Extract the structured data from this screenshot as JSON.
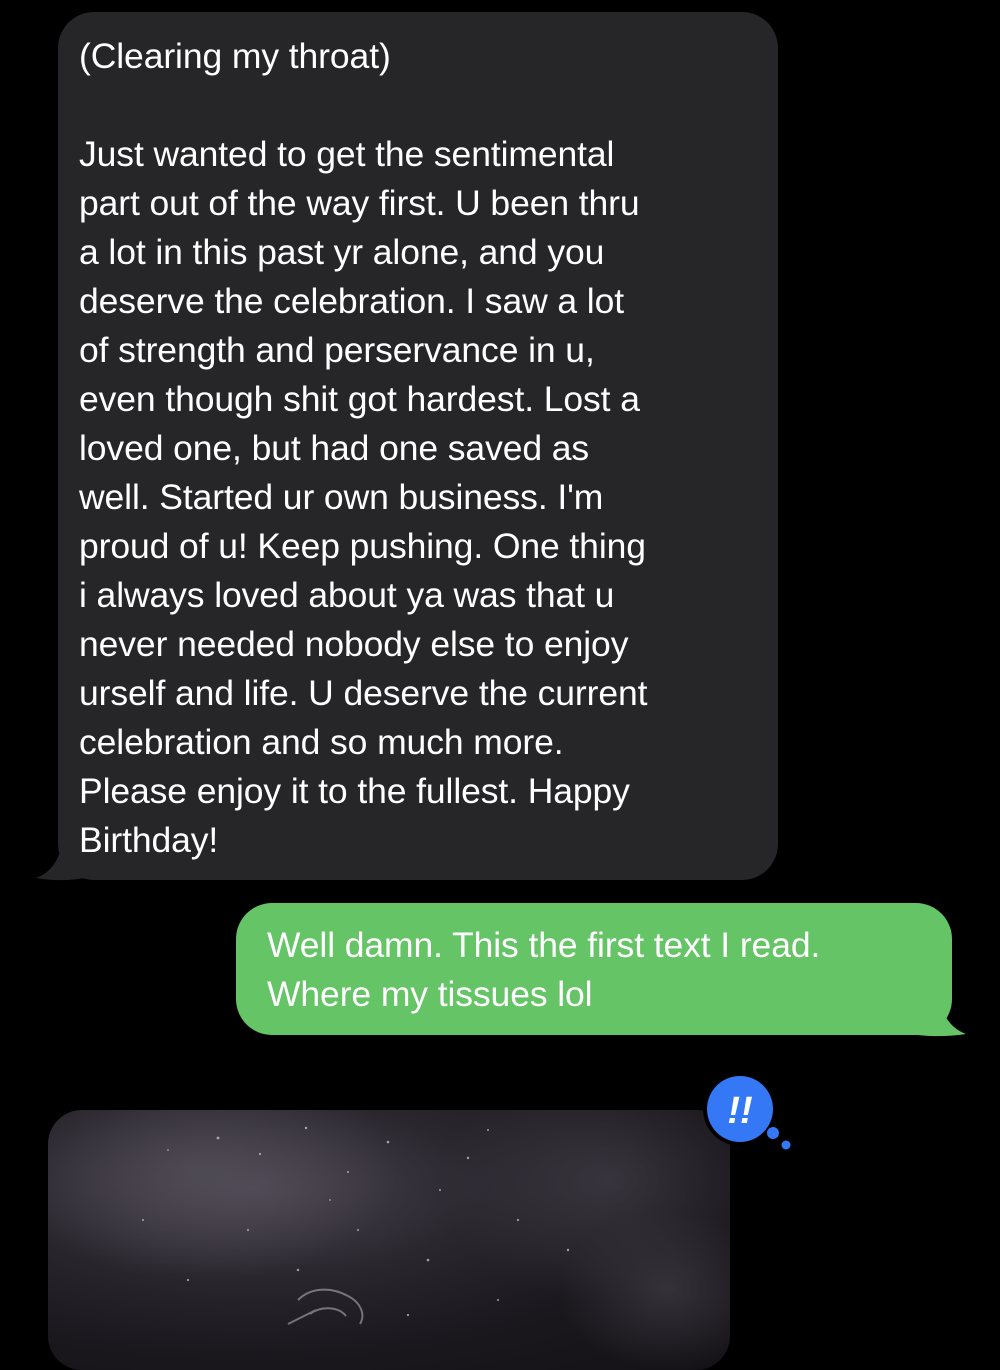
{
  "conversation": {
    "incoming_message": {
      "text": "(Clearing my throat)\n\nJust wanted to get the sentimental\npart out of the way first. U been thru\na lot in this past yr alone, and you\ndeserve the celebration. I saw a lot\nof strength and perservance in u,\neven though shit got hardest. Lost a\nloved one, but had one saved as\nwell. Started ur own business. I'm\nproud of u! Keep pushing. One thing\ni always loved about ya was that u\nnever needed nobody else to enjoy\nurself and life. U deserve the current\ncelebration and so much more.\nPlease enjoy it to the fullest. Happy\nBirthday!"
    },
    "outgoing_message": {
      "text": "Well damn. This the first text I read.\nWhere my tissues lol"
    },
    "image_message": {
      "icon": "photo-attachment"
    },
    "tapback": {
      "symbol": "!!",
      "icon": "double-exclamation-icon",
      "color": "#3478f6"
    }
  },
  "colors": {
    "background": "#000000",
    "incoming_bubble": "#262629",
    "outgoing_bubble": "#65c466",
    "text": "#ffffff"
  }
}
